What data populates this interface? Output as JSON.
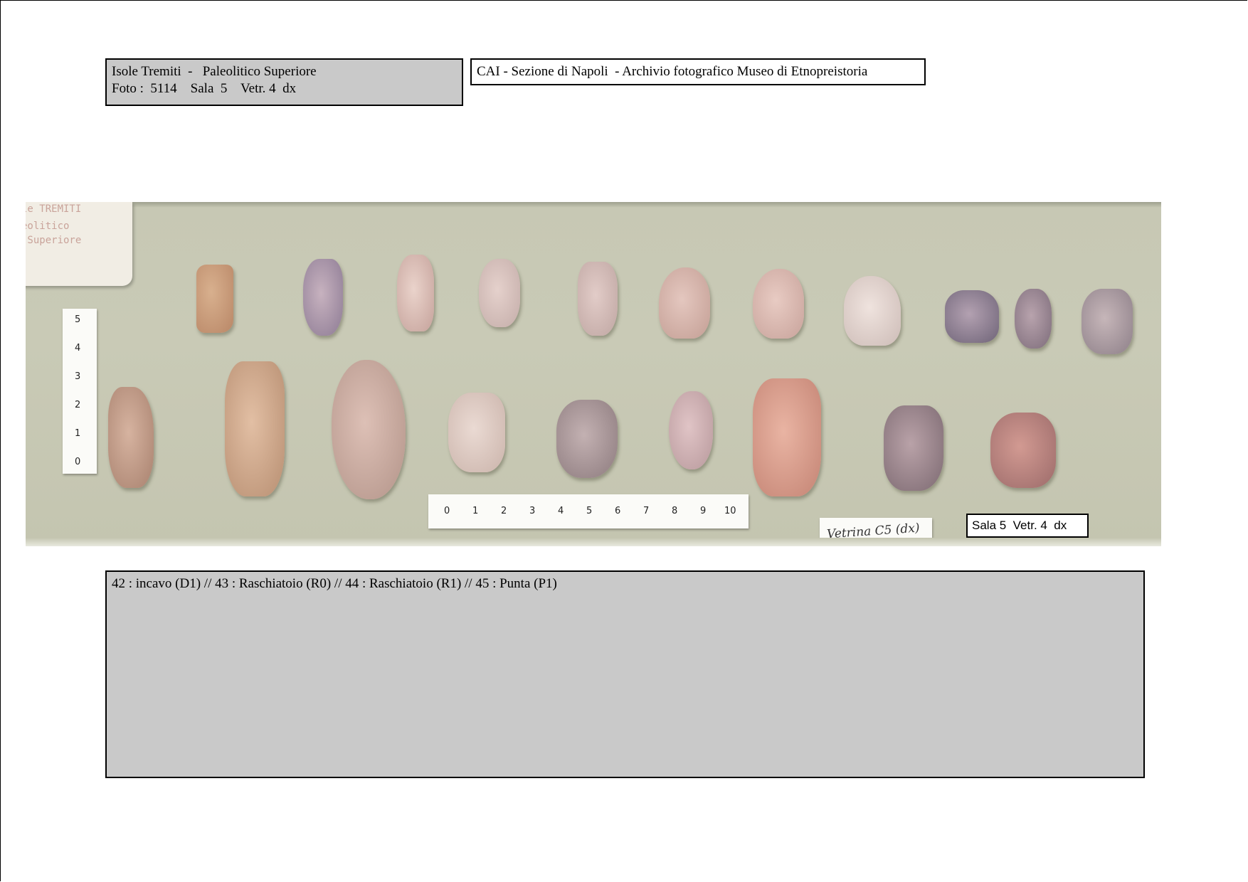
{
  "header_left": {
    "line1": "Isole Tremiti  -   Paleolitico Superiore",
    "line2": "Foto :  5114    Sala  5    Vetr. 4  dx"
  },
  "header_right": {
    "text": "CAI - Sezione di Napoli  - Archivio fotografico Museo di Etnopreistoria"
  },
  "photo": {
    "museum_card_lines": [
      "le TREMITI",
      "eolitico",
      " Superiore"
    ],
    "vertical_scale_ticks": [
      "0",
      "1",
      "2",
      "3",
      "4",
      "5"
    ],
    "horizontal_scale_ticks": [
      "0",
      "1",
      "2",
      "3",
      "4",
      "5",
      "6",
      "7",
      "8",
      "9",
      "10"
    ],
    "vetrina_label": "Vetrina C5 (dx)",
    "sala_label": "Sala 5  Vetr. 4  dx",
    "colors": {
      "background": "#c8c9b5",
      "label_card": "#f1ede4"
    }
  },
  "caption": {
    "text": "42 : incavo (D1) // 43 : Raschiatoio (R0) // 44 : Raschiatoio (R1) // 45 : Punta (P1)"
  }
}
